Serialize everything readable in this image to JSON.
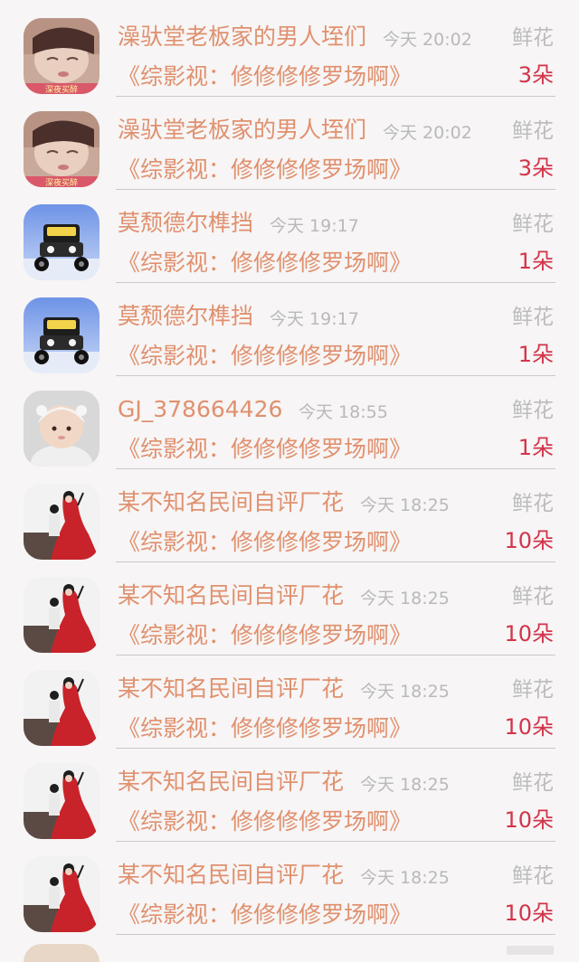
{
  "colors": {
    "background": "#f7f5f5",
    "name_text": "#e0906e",
    "time_text": "#b9b9b9",
    "type_text": "#bcbcbc",
    "count_text": "#d2344a",
    "divider": "#c9c9c9"
  },
  "rows": [
    {
      "avatar": "sleeping-girl-avatar",
      "avatar_caption": "深夜买醉",
      "name": "澡驮堂老板家的男人垤们",
      "time": "今天 20:02",
      "type": "鲜花",
      "book": "《综影视：修修修修罗场啊》",
      "count": "3朵"
    },
    {
      "avatar": "sleeping-girl-avatar",
      "avatar_caption": "深夜买醉",
      "name": "澡驮堂老板家的男人垤们",
      "time": "今天 20:02",
      "type": "鲜花",
      "book": "《综影视：修修修修罗场啊》",
      "count": "3朵"
    },
    {
      "avatar": "toy-car-avatar",
      "avatar_caption": "",
      "name": "莫颓德尔榫挡",
      "time": "今天 19:17",
      "type": "鲜花",
      "book": "《综影视：修修修修罗场啊》",
      "count": "1朵"
    },
    {
      "avatar": "toy-car-avatar",
      "avatar_caption": "",
      "name": "莫颓德尔榫挡",
      "time": "今天 19:17",
      "type": "鲜花",
      "book": "《综影视：修修修修罗场啊》",
      "count": "1朵"
    },
    {
      "avatar": "baby-avatar",
      "avatar_caption": "",
      "name": "GJ_378664426",
      "time": "今天 18:55",
      "type": "鲜花",
      "book": "《综影视：修修修修罗场啊》",
      "count": "1朵"
    },
    {
      "avatar": "red-dress-avatar",
      "avatar_caption": "",
      "name": "某不知名民间自评厂花",
      "time": "今天 18:25",
      "type": "鲜花",
      "book": "《综影视：修修修修罗场啊》",
      "count": "10朵"
    },
    {
      "avatar": "red-dress-avatar",
      "avatar_caption": "",
      "name": "某不知名民间自评厂花",
      "time": "今天 18:25",
      "type": "鲜花",
      "book": "《综影视：修修修修罗场啊》",
      "count": "10朵"
    },
    {
      "avatar": "red-dress-avatar",
      "avatar_caption": "",
      "name": "某不知名民间自评厂花",
      "time": "今天 18:25",
      "type": "鲜花",
      "book": "《综影视：修修修修罗场啊》",
      "count": "10朵"
    },
    {
      "avatar": "red-dress-avatar",
      "avatar_caption": "",
      "name": "某不知名民间自评厂花",
      "time": "今天 18:25",
      "type": "鲜花",
      "book": "《综影视：修修修修罗场啊》",
      "count": "10朵"
    },
    {
      "avatar": "red-dress-avatar",
      "avatar_caption": "",
      "name": "某不知名民间自评厂花",
      "time": "今天 18:25",
      "type": "鲜花",
      "book": "《综影视：修修修修罗场啊》",
      "count": "10朵"
    }
  ]
}
